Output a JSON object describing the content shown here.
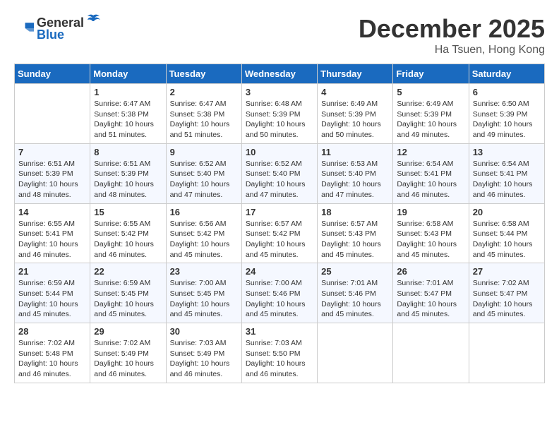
{
  "logo": {
    "general": "General",
    "blue": "Blue"
  },
  "title": {
    "month": "December 2025",
    "location": "Ha Tsuen, Hong Kong"
  },
  "weekdays": [
    "Sunday",
    "Monday",
    "Tuesday",
    "Wednesday",
    "Thursday",
    "Friday",
    "Saturday"
  ],
  "weeks": [
    [
      {
        "day": "",
        "sunrise": "",
        "sunset": "",
        "daylight": ""
      },
      {
        "day": "1",
        "sunrise": "6:47 AM",
        "sunset": "5:38 PM",
        "daylight": "10 hours and 51 minutes."
      },
      {
        "day": "2",
        "sunrise": "6:47 AM",
        "sunset": "5:38 PM",
        "daylight": "10 hours and 51 minutes."
      },
      {
        "day": "3",
        "sunrise": "6:48 AM",
        "sunset": "5:39 PM",
        "daylight": "10 hours and 50 minutes."
      },
      {
        "day": "4",
        "sunrise": "6:49 AM",
        "sunset": "5:39 PM",
        "daylight": "10 hours and 50 minutes."
      },
      {
        "day": "5",
        "sunrise": "6:49 AM",
        "sunset": "5:39 PM",
        "daylight": "10 hours and 49 minutes."
      },
      {
        "day": "6",
        "sunrise": "6:50 AM",
        "sunset": "5:39 PM",
        "daylight": "10 hours and 49 minutes."
      }
    ],
    [
      {
        "day": "7",
        "sunrise": "6:51 AM",
        "sunset": "5:39 PM",
        "daylight": "10 hours and 48 minutes."
      },
      {
        "day": "8",
        "sunrise": "6:51 AM",
        "sunset": "5:39 PM",
        "daylight": "10 hours and 48 minutes."
      },
      {
        "day": "9",
        "sunrise": "6:52 AM",
        "sunset": "5:40 PM",
        "daylight": "10 hours and 47 minutes."
      },
      {
        "day": "10",
        "sunrise": "6:52 AM",
        "sunset": "5:40 PM",
        "daylight": "10 hours and 47 minutes."
      },
      {
        "day": "11",
        "sunrise": "6:53 AM",
        "sunset": "5:40 PM",
        "daylight": "10 hours and 47 minutes."
      },
      {
        "day": "12",
        "sunrise": "6:54 AM",
        "sunset": "5:41 PM",
        "daylight": "10 hours and 46 minutes."
      },
      {
        "day": "13",
        "sunrise": "6:54 AM",
        "sunset": "5:41 PM",
        "daylight": "10 hours and 46 minutes."
      }
    ],
    [
      {
        "day": "14",
        "sunrise": "6:55 AM",
        "sunset": "5:41 PM",
        "daylight": "10 hours and 46 minutes."
      },
      {
        "day": "15",
        "sunrise": "6:55 AM",
        "sunset": "5:42 PM",
        "daylight": "10 hours and 46 minutes."
      },
      {
        "day": "16",
        "sunrise": "6:56 AM",
        "sunset": "5:42 PM",
        "daylight": "10 hours and 45 minutes."
      },
      {
        "day": "17",
        "sunrise": "6:57 AM",
        "sunset": "5:42 PM",
        "daylight": "10 hours and 45 minutes."
      },
      {
        "day": "18",
        "sunrise": "6:57 AM",
        "sunset": "5:43 PM",
        "daylight": "10 hours and 45 minutes."
      },
      {
        "day": "19",
        "sunrise": "6:58 AM",
        "sunset": "5:43 PM",
        "daylight": "10 hours and 45 minutes."
      },
      {
        "day": "20",
        "sunrise": "6:58 AM",
        "sunset": "5:44 PM",
        "daylight": "10 hours and 45 minutes."
      }
    ],
    [
      {
        "day": "21",
        "sunrise": "6:59 AM",
        "sunset": "5:44 PM",
        "daylight": "10 hours and 45 minutes."
      },
      {
        "day": "22",
        "sunrise": "6:59 AM",
        "sunset": "5:45 PM",
        "daylight": "10 hours and 45 minutes."
      },
      {
        "day": "23",
        "sunrise": "7:00 AM",
        "sunset": "5:45 PM",
        "daylight": "10 hours and 45 minutes."
      },
      {
        "day": "24",
        "sunrise": "7:00 AM",
        "sunset": "5:46 PM",
        "daylight": "10 hours and 45 minutes."
      },
      {
        "day": "25",
        "sunrise": "7:01 AM",
        "sunset": "5:46 PM",
        "daylight": "10 hours and 45 minutes."
      },
      {
        "day": "26",
        "sunrise": "7:01 AM",
        "sunset": "5:47 PM",
        "daylight": "10 hours and 45 minutes."
      },
      {
        "day": "27",
        "sunrise": "7:02 AM",
        "sunset": "5:47 PM",
        "daylight": "10 hours and 45 minutes."
      }
    ],
    [
      {
        "day": "28",
        "sunrise": "7:02 AM",
        "sunset": "5:48 PM",
        "daylight": "10 hours and 46 minutes."
      },
      {
        "day": "29",
        "sunrise": "7:02 AM",
        "sunset": "5:49 PM",
        "daylight": "10 hours and 46 minutes."
      },
      {
        "day": "30",
        "sunrise": "7:03 AM",
        "sunset": "5:49 PM",
        "daylight": "10 hours and 46 minutes."
      },
      {
        "day": "31",
        "sunrise": "7:03 AM",
        "sunset": "5:50 PM",
        "daylight": "10 hours and 46 minutes."
      },
      {
        "day": "",
        "sunrise": "",
        "sunset": "",
        "daylight": ""
      },
      {
        "day": "",
        "sunrise": "",
        "sunset": "",
        "daylight": ""
      },
      {
        "day": "",
        "sunrise": "",
        "sunset": "",
        "daylight": ""
      }
    ]
  ]
}
